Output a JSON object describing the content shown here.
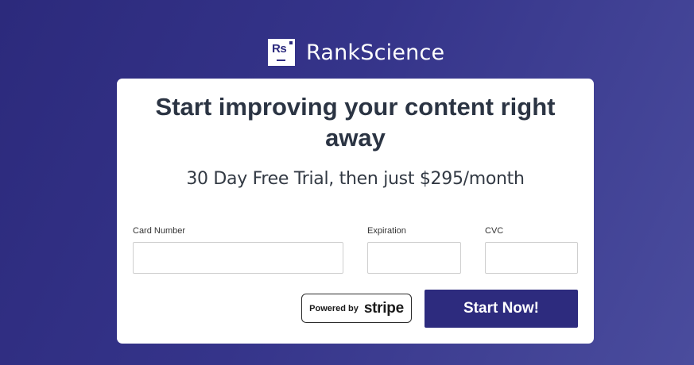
{
  "brand": {
    "logo_text": "Rs",
    "name": "RankScience"
  },
  "card": {
    "headline": "Start improving your content right away",
    "subline": "30 Day Free Trial, then just $295/month"
  },
  "form": {
    "card_number_label": "Card Number",
    "card_number_value": "",
    "expiration_label": "Expiration",
    "expiration_value": "",
    "cvc_label": "CVC",
    "cvc_value": ""
  },
  "stripe_badge": {
    "powered_by": "Powered by",
    "stripe": "stripe"
  },
  "submit": {
    "label": "Start Now!"
  },
  "colors": {
    "accent": "#2d2b7e",
    "background_start": "#2c2a7c",
    "background_end": "#4a4c9d",
    "heading_text": "#2b3443"
  }
}
